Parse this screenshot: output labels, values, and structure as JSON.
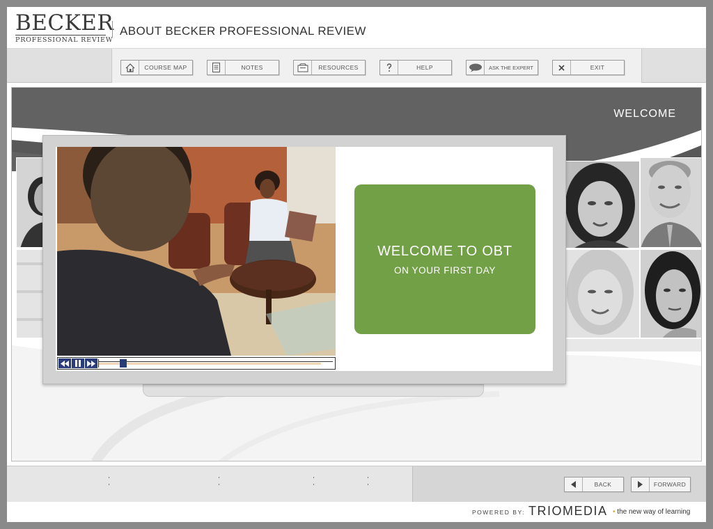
{
  "header": {
    "logo_main": "BECKER",
    "logo_sub": "PROFESSIONAL REVIEW",
    "page_title": "ABOUT BECKER PROFESSIONAL REVIEW"
  },
  "toolbar": {
    "buttons": [
      {
        "label": "COURSE MAP",
        "icon": "home-icon"
      },
      {
        "label": "NOTES",
        "icon": "notes-icon"
      },
      {
        "label": "RESOURCES",
        "icon": "resources-icon"
      },
      {
        "label": "HELP",
        "icon": "help-icon"
      },
      {
        "label": "ASK THE EXPERT",
        "icon": "speech-bubble-icon"
      },
      {
        "label": "EXIT",
        "icon": "close-icon"
      }
    ]
  },
  "stage": {
    "title": "WELCOME",
    "welcome_card": {
      "line1": "WELCOME TO OBT",
      "line2": "ON YOUR FIRST DAY",
      "color": "#72a046"
    },
    "video": {
      "progress": 0.09,
      "buffered": 0.95
    }
  },
  "navigation": {
    "back_label": "BACK",
    "forward_label": "FORWARD"
  },
  "footer": {
    "powered_by": "POWERED BY:",
    "brand": "TRIOMEDIA",
    "tagline": "the new way of learning"
  }
}
